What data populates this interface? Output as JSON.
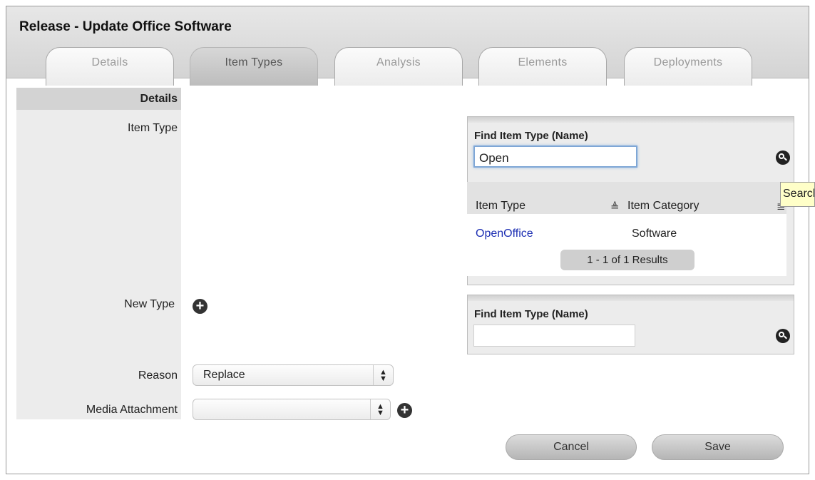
{
  "window": {
    "title": "Release - Update Office Software"
  },
  "tabs": [
    {
      "label": "Details",
      "active": false
    },
    {
      "label": "Item Types",
      "active": true
    },
    {
      "label": "Analysis",
      "active": false
    },
    {
      "label": "Elements",
      "active": false
    },
    {
      "label": "Deployments",
      "active": false
    }
  ],
  "form": {
    "section_label": "Details",
    "item_type_label": "Item Type",
    "new_type_label": "New Type",
    "reason_label": "Reason",
    "reason_value": "Replace",
    "media_label": "Media Attachment",
    "media_value": ""
  },
  "find_panel_1": {
    "title": "Find Item Type (Name)",
    "input_value": "Open",
    "columns": [
      "Item Type",
      "Item Category"
    ],
    "rows": [
      {
        "item_type": "OpenOffice",
        "item_category": "Software"
      }
    ],
    "pager": "1 - 1 of 1 Results",
    "tooltip": "Search"
  },
  "find_panel_2": {
    "title": "Find Item Type (Name)",
    "input_value": ""
  },
  "buttons": {
    "cancel": "Cancel",
    "save": "Save"
  },
  "icons": {
    "add": "plus-circle",
    "search": "magnifier-circle",
    "sort": "sort-lines",
    "select": "up-down-arrows"
  },
  "colors": {
    "link": "#1d2fb3",
    "focus": "#7fa7d6",
    "tooltip_bg": "#ffffc8"
  }
}
